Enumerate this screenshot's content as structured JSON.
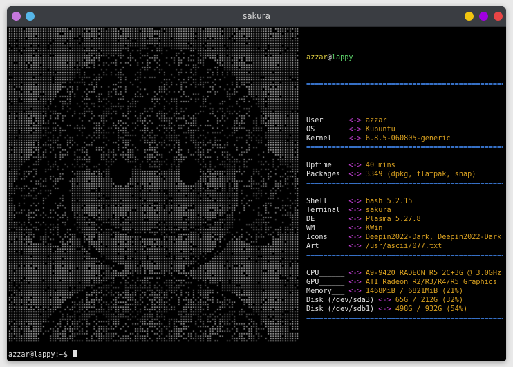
{
  "window": {
    "title": "sakura",
    "left_buttons": [
      "#c678dd",
      "#56b6e8"
    ],
    "right_buttons": [
      "#f1c40f",
      "#a000e0",
      "#e84545"
    ]
  },
  "art": {
    "description_icon": "ascii-art-portrait-icon",
    "fg": "#d0d0d0"
  },
  "info": {
    "user": "azzar",
    "at": "@",
    "host": "lappy",
    "separator": "=================================================",
    "groups": [
      [
        {
          "key": "User_____ ",
          "arrow": "<->",
          "value": " azzar"
        },
        {
          "key": "OS_______ ",
          "arrow": "<->",
          "value": " Kubuntu"
        },
        {
          "key": "Kernel___ ",
          "arrow": "<->",
          "value": " 6.8.5-060805-generic"
        }
      ],
      [
        {
          "key": "Uptime___ ",
          "arrow": "<->",
          "value": " 40 mins"
        },
        {
          "key": "Packages_ ",
          "arrow": "<->",
          "value": " 3349 (dpkg, flatpak, snap)"
        }
      ],
      [
        {
          "key": "Shell____ ",
          "arrow": "<->",
          "value": " bash 5.2.15"
        },
        {
          "key": "Terminal_ ",
          "arrow": "<->",
          "value": " sakura"
        },
        {
          "key": "DE_______ ",
          "arrow": "<->",
          "value": " Plasma 5.27.8"
        },
        {
          "key": "WM_______ ",
          "arrow": "<->",
          "value": " KWin"
        },
        {
          "key": "Icons____ ",
          "arrow": "<->",
          "value": " Deepin2022-Dark, Deepin2022-Dark"
        },
        {
          "key": "Art______ ",
          "arrow": "<->",
          "value": " /usr/ascii/077.txt"
        }
      ],
      [
        {
          "key": "CPU______ ",
          "arrow": "<->",
          "value": " A9-9420 RADEON R5 2C+3G @ 3.0GHz"
        },
        {
          "key": "GPU______ ",
          "arrow": "<->",
          "value": " ATI Radeon R2/R3/R4/R5 Graphics"
        },
        {
          "key": "Memory___ ",
          "arrow": "<->",
          "value": " 1468MiB / 6821MiB (21%)"
        },
        {
          "key": "Disk (/dev/sda3) ",
          "arrow": "<->",
          "value": " 65G / 212G (32%)"
        },
        {
          "key": "Disk (/dev/sdb1) ",
          "arrow": "<->",
          "value": " 498G / 932G (54%)"
        }
      ]
    ]
  },
  "prompt": {
    "text": "azzar@lappy:~$ "
  }
}
